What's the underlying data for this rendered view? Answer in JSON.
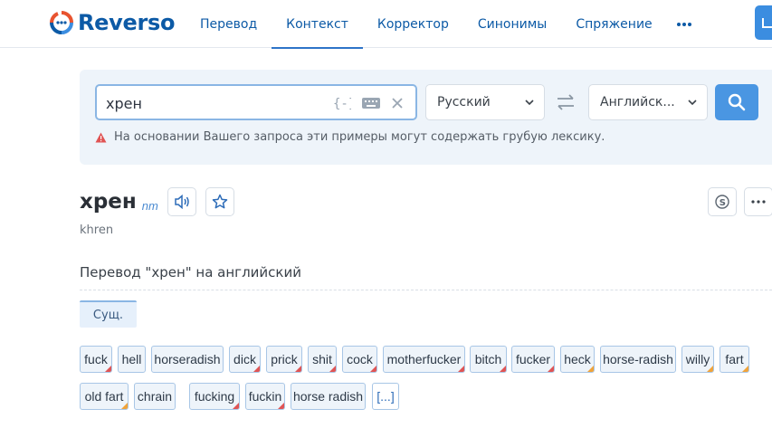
{
  "app": {
    "name": "Reverso",
    "colors": {
      "brand": "#0c5aa6",
      "accent": "#4a96e2",
      "warning": "#e05454",
      "flag_orange": "#f0a33a"
    }
  },
  "nav": {
    "items": [
      "Перевод",
      "Контекст",
      "Корректор",
      "Синонимы",
      "Спряжение"
    ],
    "active": "Контекст",
    "more_icon": "ellipsis-icon"
  },
  "search": {
    "query": "хрен",
    "source_lang": "Русский",
    "target_lang": "Английск...",
    "icons": [
      "regex-icon",
      "keyboard-icon",
      "close-icon",
      "swap-icon",
      "search-icon"
    ]
  },
  "warning": {
    "text": "На основании Вашего запроса эти примеры могут содержать грубую лексику."
  },
  "entry": {
    "word": "хрен",
    "pos": "nm",
    "transliteration": "khren",
    "section_title": "Перевод \"хрен\" на английский",
    "pos_tab": "Сущ."
  },
  "translations": [
    {
      "text": "fuck",
      "flag": "red"
    },
    {
      "text": "hell",
      "flag": "none"
    },
    {
      "text": "horseradish",
      "flag": "none"
    },
    {
      "text": "dick",
      "flag": "red"
    },
    {
      "text": "prick",
      "flag": "red"
    },
    {
      "text": "shit",
      "flag": "red"
    },
    {
      "text": "cock",
      "flag": "red"
    },
    {
      "text": "motherfucker",
      "flag": "red"
    },
    {
      "text": "bitch",
      "flag": "red"
    },
    {
      "text": "fucker",
      "flag": "red"
    },
    {
      "text": "heck",
      "flag": "orange"
    },
    {
      "text": "horse-radish",
      "flag": "none"
    },
    {
      "text": "willy",
      "flag": "orange"
    },
    {
      "text": "fart",
      "flag": "orange"
    },
    {
      "text": "old fart",
      "flag": "orange"
    },
    {
      "text": "chrain",
      "flag": "none"
    },
    {
      "text": "fucking",
      "flag": "red"
    },
    {
      "text": "fuckin",
      "flag": "red"
    },
    {
      "text": "horse radish",
      "flag": "none"
    },
    {
      "text": "[...]",
      "flag": "more"
    }
  ]
}
